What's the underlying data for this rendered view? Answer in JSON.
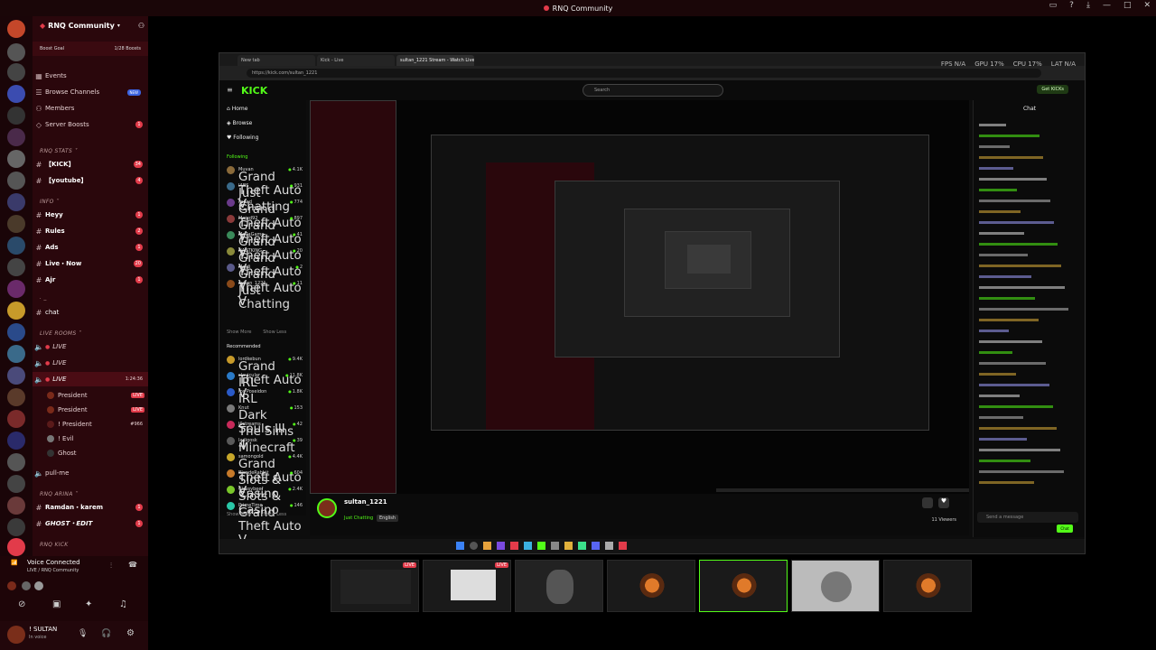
{
  "window": {
    "title": "RNQ Community"
  },
  "server": {
    "name": "RNQ Community",
    "boost_goal": "Boost Goal",
    "boost_count": "1/28 Boosts",
    "menu": [
      {
        "icon": "calendar-icon",
        "label": "Events"
      },
      {
        "icon": "browse-icon",
        "label": "Browse Channels",
        "badge": "NEW"
      },
      {
        "icon": "members-icon",
        "label": "Members"
      },
      {
        "icon": "boost-icon",
        "label": "Server Boosts",
        "count": "1"
      }
    ]
  },
  "categories": {
    "rnq_stats": "RNQ STATS",
    "info": "INFO",
    "dot": ". _",
    "live_rooms": "LIVE ROOMS",
    "rnq_arina": "RNQ ARINA",
    "rnq_kick": "RNQ KICK"
  },
  "channels": {
    "kick": {
      "label": "【KICK】",
      "count": "34"
    },
    "youtube": {
      "label": "【youtube】",
      "count": "4"
    },
    "heyy": {
      "label": "Heyy",
      "count": "1"
    },
    "rules": {
      "label": "Rules",
      "count": "2"
    },
    "ads": {
      "label": "Ads",
      "count": "1"
    },
    "live_now": {
      "label": "Live・Now",
      "count": "20"
    },
    "ajr": {
      "label": "Ajr",
      "count": "1"
    },
    "chat": {
      "label": "chat"
    },
    "live1": {
      "label": "LIVE"
    },
    "live2": {
      "label": "LIVE"
    },
    "live3": {
      "label": "LIVE",
      "time": "1:24:36"
    },
    "pull_me": {
      "label": "pull-me"
    },
    "ramdan_karem": {
      "label": "Ramdan・karem",
      "count": "1"
    },
    "ghost_edit": {
      "label": "GHOST・EDIT",
      "count": "1"
    }
  },
  "voice_users": [
    {
      "name": "President",
      "badge": "LIVE"
    },
    {
      "name": "President",
      "badge": "LIVE"
    },
    {
      "name": "! President",
      "extra": "#966"
    },
    {
      "name": "! Evil"
    },
    {
      "name": "Ghost"
    }
  ],
  "voice": {
    "status": "Voice Connected",
    "channel": "LIVE / RNQ Community"
  },
  "user": {
    "name": "! SULTAN",
    "status": "In voice"
  },
  "browser": {
    "tabs": [
      "New tab",
      "Kick - Live",
      "sultan_1221 Stream - Watch Live"
    ],
    "url": "https://kick.com/sultan_1221",
    "perf": {
      "fps": "FPS N/A",
      "gpu": "GPU 17%",
      "cpu": "CPU 17%",
      "lat": "LAT N/A"
    }
  },
  "kick": {
    "logo": "KICK",
    "search_placeholder": "Search",
    "get_kicks": "Get KICKs",
    "nav": [
      "Home",
      "Browse",
      "Following"
    ],
    "following_label": "Following",
    "recommended_label": "Recommended",
    "show_more": "Show More",
    "show_less": "Show Less",
    "following": [
      {
        "name": "Muvan",
        "sub": "Grand Theft Auto V",
        "viewers": "4.1K",
        "color": "#8a6a3a"
      },
      {
        "name": "IABS",
        "sub": "Just Chatting",
        "viewers": "931",
        "color": "#3a6a8a"
      },
      {
        "name": "Fahad",
        "sub": "Grand Theft Auto V",
        "viewers": "774",
        "color": "#6a3a8a"
      },
      {
        "name": "Majed92",
        "sub": "Grand Theft Auto V",
        "viewers": "897",
        "color": "#8a3a3a"
      },
      {
        "name": "Mo7aGame",
        "sub": "Grand Theft Auto V",
        "viewers": "41",
        "color": "#3a8a5a"
      },
      {
        "name": "HABTKING",
        "sub": "Grand Theft Auto V",
        "viewers": "20",
        "color": "#8a8a3a"
      },
      {
        "name": "Majdi",
        "sub": "Grand Theft Auto V",
        "viewers": "2",
        "color": "#5a5a8a"
      },
      {
        "name": "sultan_1221",
        "sub": "Just Chatting",
        "viewers": "11",
        "color": "#8a4a1a"
      }
    ],
    "recommended": [
      {
        "name": "lordkebun",
        "sub": "Grand Theft Auto V",
        "viewers": "9.4K",
        "color": "#c79a2a"
      },
      {
        "name": "clavicular",
        "sub": "IRL",
        "viewers": "11.8K",
        "color": "#2a7ac7"
      },
      {
        "name": "Ice Poseidon",
        "sub": "IRL",
        "viewers": "1.8K",
        "color": "#2a5ac7"
      },
      {
        "name": "Knut",
        "sub": "Dark Souls III",
        "viewers": "153",
        "color": "#7a7a7a"
      },
      {
        "name": "J0streams",
        "sub": "The Sims 4",
        "viewers": "42",
        "color": "#c72a5a"
      },
      {
        "name": "ladigosk",
        "sub": "Minecraft",
        "viewers": "39",
        "color": "#5a5a5a"
      },
      {
        "name": "samongold",
        "sub": "Grand Theft Auto V",
        "viewers": "4.4K",
        "color": "#c7a72a"
      },
      {
        "name": "BlondeRabbit",
        "sub": "Slots & Casino",
        "viewers": "604",
        "color": "#c77a2a"
      },
      {
        "name": "Classybeef",
        "sub": "Slots & Casino",
        "viewers": "2.4K",
        "color": "#7ac72a"
      },
      {
        "name": "PrimeTime",
        "sub": "Grand Theft Auto V",
        "viewers": "146",
        "color": "#2ac7a7"
      }
    ],
    "chat_title": "Chat",
    "chat_placeholder": "Send a message",
    "chat_send": "Chat",
    "streamer": {
      "name": "sultan_1221",
      "category": "Just Chatting",
      "language": "English",
      "viewers": "11 Viewers"
    }
  },
  "thumbnails": [
    {
      "live": "LIVE"
    },
    {
      "live": "LIVE"
    },
    {},
    {},
    {},
    {},
    {}
  ],
  "colors": {
    "kick_green": "#53fc18",
    "discord_red": "#e23b4a"
  }
}
